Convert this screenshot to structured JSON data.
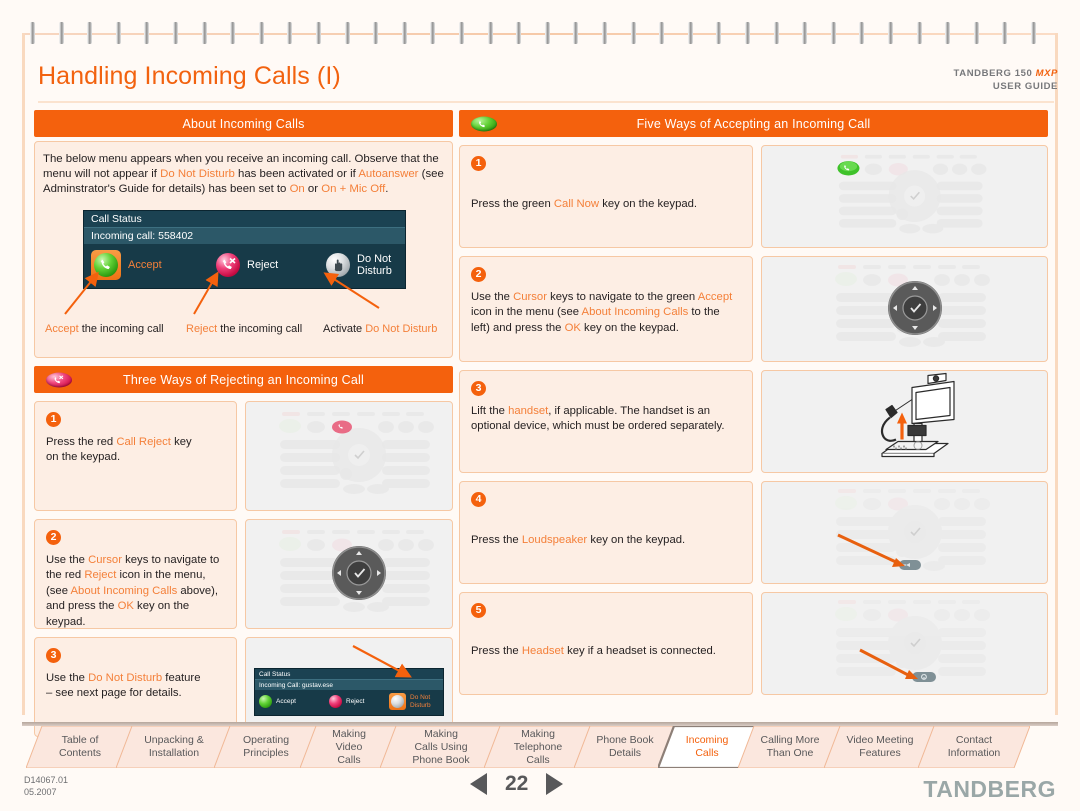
{
  "header": {
    "title": "Handling Incoming Calls (I)",
    "brand_product": "TANDBERG 150 ",
    "brand_product_em": "MXP",
    "brand_guide": "USER GUIDE"
  },
  "about": {
    "heading": "About Incoming Calls",
    "paragraph": {
      "t1": "The below menu appears when you receive an incoming call. Observe that the menu will not appear if ",
      "dnd": "Do Not Disturb",
      "t2": " has been activated or if ",
      "autoanswer": "Autoanswer",
      "t3": " (see Adminstrator's Guide for details) has been set to ",
      "on": "On",
      "t4": " or ",
      "onmic": "On + Mic Off",
      "t5": "."
    },
    "menu": {
      "title": "Call Status",
      "subtitle": "Incoming call: 558402",
      "accept": "Accept",
      "reject": "Reject",
      "dnd_line1": "Do Not",
      "dnd_line2": "Disturb"
    },
    "callouts": {
      "accept_a": "Accept",
      "accept_b": " the incoming call",
      "reject_a": "Reject",
      "reject_b": " the incoming call",
      "dnd_a": "Activate ",
      "dnd_b": "Do Not Disturb"
    }
  },
  "reject_section": {
    "heading": "Three Ways of Rejecting an Incoming Call",
    "badge": "red-reject-pill",
    "steps": [
      {
        "num": "1",
        "text": {
          "t1": "Press the red ",
          "hl1": "Call Reject",
          "t2": " key",
          "t3": "on the keypad."
        },
        "pic": "remote-call-reject"
      },
      {
        "num": "2",
        "text": {
          "t1": "Use the ",
          "hl1": "Cursor",
          "t2": " keys to navigate to the red ",
          "hl2": "Reject",
          "t3": " icon  in the menu, (see ",
          "hl3": "About Incoming Calls",
          "t4": " above), and press the ",
          "hl4": "OK",
          "t5": " key on the keypad."
        },
        "pic": "remote-ok-cursor"
      },
      {
        "num": "3",
        "text": {
          "t1": "Use the ",
          "hl1": "Do Not Disturb",
          "t2": " feature",
          "t3": "– see next page for details."
        },
        "pic": "callmenu-dnd",
        "menu": {
          "title": "Call Status",
          "subtitle": "Incoming Call: gustav.ese",
          "accept": "Accept",
          "reject": "Reject",
          "dnd_line1": "Do Not",
          "dnd_line2": "Disturb"
        }
      }
    ]
  },
  "accept_section": {
    "heading": "Five Ways of Accepting an Incoming Call",
    "badge": "green-accept-pill",
    "steps": [
      {
        "num": "1",
        "text": {
          "t1": "Press the green ",
          "hl1": "Call Now",
          "t2": " key on the keypad."
        },
        "pic": "remote-call-now"
      },
      {
        "num": "2",
        "text": {
          "t1": "Use the ",
          "hl1": "Cursor",
          "t2": " keys to navigate to the green ",
          "hl2": "Accept",
          "t3": " icon in the menu (see ",
          "hl3": "About Incoming Calls",
          "t4": " to the left) and press the ",
          "hl4": "OK",
          "t5": " key on the keypad."
        },
        "pic": "remote-ok-cursor"
      },
      {
        "num": "3",
        "text": {
          "t1": "Lift the ",
          "hl1": "handset",
          "t2": ", if applicable. The handset is an optional device, which must be ordered separately."
        },
        "pic": "system-handset"
      },
      {
        "num": "4",
        "text": {
          "t1": "Press the ",
          "hl1": "Loudspeaker",
          "t2": " key on the keypad."
        },
        "pic": "remote-loudspeaker"
      },
      {
        "num": "5",
        "text": {
          "t1": "Press the ",
          "hl1": "Headset",
          "t2": " key if a headset is connected."
        },
        "pic": "remote-headset"
      }
    ]
  },
  "tabs": [
    {
      "id": "table-of-contents",
      "lines": [
        "Table of",
        "Contents"
      ],
      "active": false
    },
    {
      "id": "unpacking-installation",
      "lines": [
        "Unpacking &",
        "Installation"
      ],
      "active": false
    },
    {
      "id": "operating-principles",
      "lines": [
        "Operating",
        "Principles"
      ],
      "active": false
    },
    {
      "id": "making-video-calls",
      "lines": [
        "Making",
        "Video",
        "Calls"
      ],
      "active": false
    },
    {
      "id": "making-calls-using-phone-book",
      "lines": [
        "Making",
        "Calls Using",
        "Phone Book"
      ],
      "active": false
    },
    {
      "id": "making-telephone-calls",
      "lines": [
        "Making",
        "Telephone",
        "Calls"
      ],
      "active": false
    },
    {
      "id": "phone-book-details",
      "lines": [
        "Phone Book",
        "Details"
      ],
      "active": false
    },
    {
      "id": "incoming-calls",
      "lines": [
        "Incoming",
        "Calls"
      ],
      "active": true
    },
    {
      "id": "calling-more-than-one",
      "lines": [
        "Calling More",
        "Than One"
      ],
      "active": false
    },
    {
      "id": "video-meeting-features",
      "lines": [
        "Video Meeting",
        "Features"
      ],
      "active": false
    },
    {
      "id": "contact-information",
      "lines": [
        "Contact",
        "Information"
      ],
      "active": false
    }
  ],
  "footer": {
    "doc_id": "D14067.01",
    "doc_date": "05.2007",
    "page_number": "22",
    "logo": "TANDBERG"
  },
  "colors": {
    "orange": "#f4610d",
    "orange_light": "#f4803a",
    "panel_bg": "#fdeee4",
    "panel_border": "#f6c8a4",
    "pic_bg": "#f1f1f1",
    "menu_dark": "#12313d"
  }
}
